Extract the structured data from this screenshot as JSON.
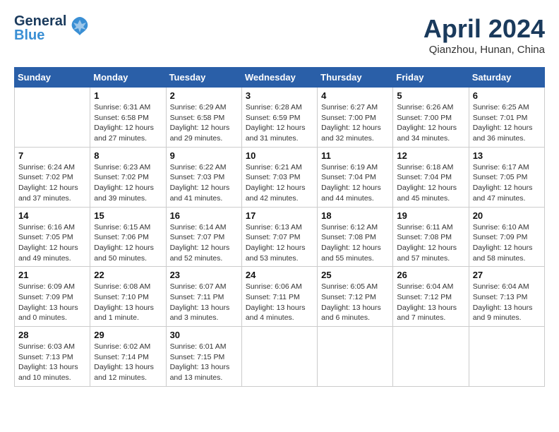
{
  "header": {
    "logo_line1": "General",
    "logo_line2": "Blue",
    "month": "April 2024",
    "location": "Qianzhou, Hunan, China"
  },
  "weekdays": [
    "Sunday",
    "Monday",
    "Tuesday",
    "Wednesday",
    "Thursday",
    "Friday",
    "Saturday"
  ],
  "weeks": [
    [
      {
        "day": "",
        "info": ""
      },
      {
        "day": "1",
        "info": "Sunrise: 6:31 AM\nSunset: 6:58 PM\nDaylight: 12 hours\nand 27 minutes."
      },
      {
        "day": "2",
        "info": "Sunrise: 6:29 AM\nSunset: 6:58 PM\nDaylight: 12 hours\nand 29 minutes."
      },
      {
        "day": "3",
        "info": "Sunrise: 6:28 AM\nSunset: 6:59 PM\nDaylight: 12 hours\nand 31 minutes."
      },
      {
        "day": "4",
        "info": "Sunrise: 6:27 AM\nSunset: 7:00 PM\nDaylight: 12 hours\nand 32 minutes."
      },
      {
        "day": "5",
        "info": "Sunrise: 6:26 AM\nSunset: 7:00 PM\nDaylight: 12 hours\nand 34 minutes."
      },
      {
        "day": "6",
        "info": "Sunrise: 6:25 AM\nSunset: 7:01 PM\nDaylight: 12 hours\nand 36 minutes."
      }
    ],
    [
      {
        "day": "7",
        "info": "Sunrise: 6:24 AM\nSunset: 7:02 PM\nDaylight: 12 hours\nand 37 minutes."
      },
      {
        "day": "8",
        "info": "Sunrise: 6:23 AM\nSunset: 7:02 PM\nDaylight: 12 hours\nand 39 minutes."
      },
      {
        "day": "9",
        "info": "Sunrise: 6:22 AM\nSunset: 7:03 PM\nDaylight: 12 hours\nand 41 minutes."
      },
      {
        "day": "10",
        "info": "Sunrise: 6:21 AM\nSunset: 7:03 PM\nDaylight: 12 hours\nand 42 minutes."
      },
      {
        "day": "11",
        "info": "Sunrise: 6:19 AM\nSunset: 7:04 PM\nDaylight: 12 hours\nand 44 minutes."
      },
      {
        "day": "12",
        "info": "Sunrise: 6:18 AM\nSunset: 7:04 PM\nDaylight: 12 hours\nand 45 minutes."
      },
      {
        "day": "13",
        "info": "Sunrise: 6:17 AM\nSunset: 7:05 PM\nDaylight: 12 hours\nand 47 minutes."
      }
    ],
    [
      {
        "day": "14",
        "info": "Sunrise: 6:16 AM\nSunset: 7:05 PM\nDaylight: 12 hours\nand 49 minutes."
      },
      {
        "day": "15",
        "info": "Sunrise: 6:15 AM\nSunset: 7:06 PM\nDaylight: 12 hours\nand 50 minutes."
      },
      {
        "day": "16",
        "info": "Sunrise: 6:14 AM\nSunset: 7:07 PM\nDaylight: 12 hours\nand 52 minutes."
      },
      {
        "day": "17",
        "info": "Sunrise: 6:13 AM\nSunset: 7:07 PM\nDaylight: 12 hours\nand 53 minutes."
      },
      {
        "day": "18",
        "info": "Sunrise: 6:12 AM\nSunset: 7:08 PM\nDaylight: 12 hours\nand 55 minutes."
      },
      {
        "day": "19",
        "info": "Sunrise: 6:11 AM\nSunset: 7:08 PM\nDaylight: 12 hours\nand 57 minutes."
      },
      {
        "day": "20",
        "info": "Sunrise: 6:10 AM\nSunset: 7:09 PM\nDaylight: 12 hours\nand 58 minutes."
      }
    ],
    [
      {
        "day": "21",
        "info": "Sunrise: 6:09 AM\nSunset: 7:09 PM\nDaylight: 13 hours\nand 0 minutes."
      },
      {
        "day": "22",
        "info": "Sunrise: 6:08 AM\nSunset: 7:10 PM\nDaylight: 13 hours\nand 1 minute."
      },
      {
        "day": "23",
        "info": "Sunrise: 6:07 AM\nSunset: 7:11 PM\nDaylight: 13 hours\nand 3 minutes."
      },
      {
        "day": "24",
        "info": "Sunrise: 6:06 AM\nSunset: 7:11 PM\nDaylight: 13 hours\nand 4 minutes."
      },
      {
        "day": "25",
        "info": "Sunrise: 6:05 AM\nSunset: 7:12 PM\nDaylight: 13 hours\nand 6 minutes."
      },
      {
        "day": "26",
        "info": "Sunrise: 6:04 AM\nSunset: 7:12 PM\nDaylight: 13 hours\nand 7 minutes."
      },
      {
        "day": "27",
        "info": "Sunrise: 6:04 AM\nSunset: 7:13 PM\nDaylight: 13 hours\nand 9 minutes."
      }
    ],
    [
      {
        "day": "28",
        "info": "Sunrise: 6:03 AM\nSunset: 7:13 PM\nDaylight: 13 hours\nand 10 minutes."
      },
      {
        "day": "29",
        "info": "Sunrise: 6:02 AM\nSunset: 7:14 PM\nDaylight: 13 hours\nand 12 minutes."
      },
      {
        "day": "30",
        "info": "Sunrise: 6:01 AM\nSunset: 7:15 PM\nDaylight: 13 hours\nand 13 minutes."
      },
      {
        "day": "",
        "info": ""
      },
      {
        "day": "",
        "info": ""
      },
      {
        "day": "",
        "info": ""
      },
      {
        "day": "",
        "info": ""
      }
    ]
  ]
}
